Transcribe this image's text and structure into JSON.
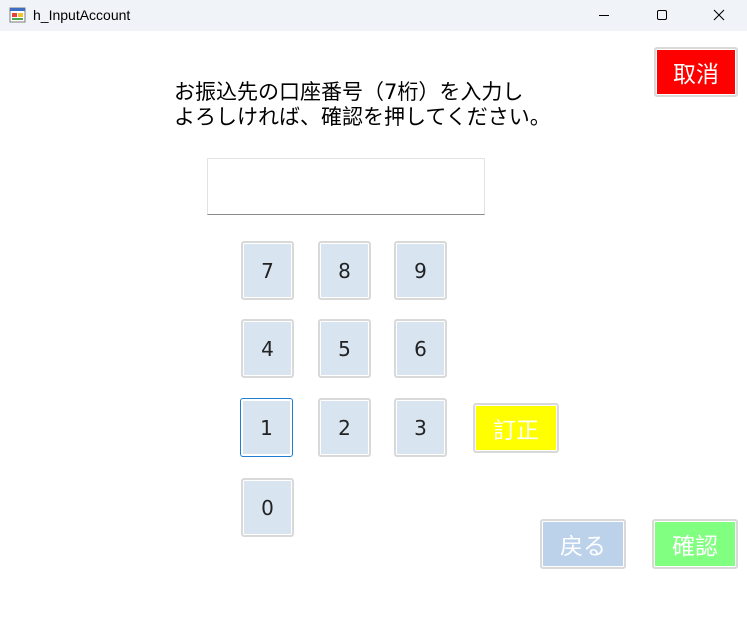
{
  "window": {
    "title": "h_InputAccount",
    "icon": "form-app-icon",
    "controls": [
      "minimize-icon",
      "maximize-icon",
      "close-icon"
    ]
  },
  "instruction": {
    "line1": "お振込先の口座番号（7桁）を入力し",
    "line2": "よろしければ、確認を押してください。"
  },
  "account_input": {
    "value": "",
    "placeholder": ""
  },
  "keypad": {
    "keys": [
      "7",
      "8",
      "9",
      "4",
      "5",
      "6",
      "1",
      "2",
      "3",
      "0"
    ],
    "focused_key": "1"
  },
  "buttons": {
    "cancel": "取消",
    "correct": "訂正",
    "back": "戻る",
    "confirm": "確認"
  },
  "colors": {
    "cancel": "#ff0000",
    "correct": "#ffff00",
    "back": "#bcd2eb",
    "confirm": "#80ff80",
    "key": "#d8e4f0",
    "titlebar": "#f0f4f9"
  }
}
